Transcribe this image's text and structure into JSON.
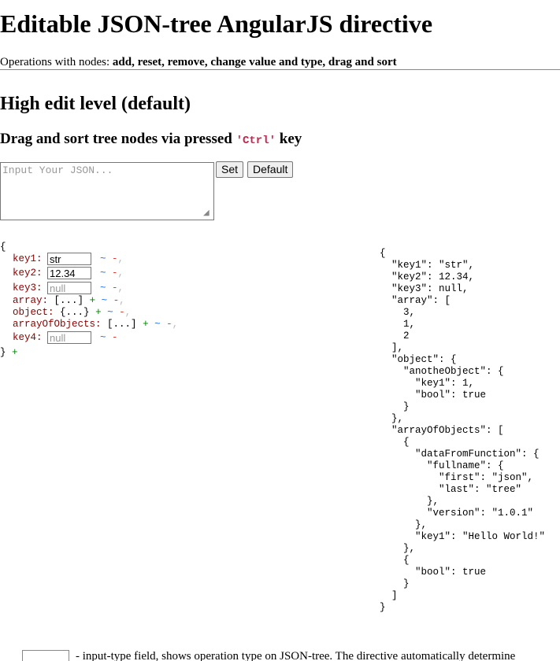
{
  "header": {
    "title": "Editable JSON-tree AngularJS directive",
    "intro_prefix": "Operations with nodes: ",
    "intro_ops": "add, reset, remove, change value and type, drag and sort"
  },
  "section": {
    "title": "High edit level (default)",
    "subtitle_before": "Drag and sort tree nodes via pressed ",
    "subtitle_key": "'Ctrl'",
    "subtitle_after": " key"
  },
  "input": {
    "placeholder": "Input Your JSON...",
    "value": "",
    "set_label": "Set",
    "default_label": "Default"
  },
  "tree": {
    "open_brace": "{",
    "close_brace": "}",
    "controls": {
      "add": "+",
      "reset": "~",
      "remove": "-",
      "comma": ","
    },
    "rows": [
      {
        "key": "key1:",
        "value": "str",
        "placeholder": ""
      },
      {
        "key": "key2:",
        "value": "12.34",
        "placeholder": ""
      },
      {
        "key": "key3:",
        "value": "",
        "placeholder": "null"
      },
      {
        "key": "array:",
        "collapsed": "[...]"
      },
      {
        "key": "object:",
        "collapsed": "{...}"
      },
      {
        "key": "arrayOfObjects:",
        "collapsed": "[...]"
      },
      {
        "key": "key4:",
        "value": "",
        "placeholder": "null"
      }
    ]
  },
  "output_json": "{\n  \"key1\": \"str\",\n  \"key2\": 12.34,\n  \"key3\": null,\n  \"array\": [\n    3,\n    1,\n    2\n  ],\n  \"object\": {\n    \"anotheObject\": {\n      \"key1\": 1,\n      \"bool\": true\n    }\n  },\n  \"arrayOfObjects\": [\n    {\n      \"dataFromFunction\": {\n        \"fullname\": {\n          \"first\": \"json\",\n          \"last\": \"tree\"\n        },\n        \"version\": \"1.0.1\"\n      },\n      \"key1\": \"Hello World!\"\n    },\n    {\n      \"bool\": true\n    }\n  ]\n}",
  "footer": {
    "text": "- input-type field, shows operation type on JSON-tree. The directive automatically determine"
  }
}
